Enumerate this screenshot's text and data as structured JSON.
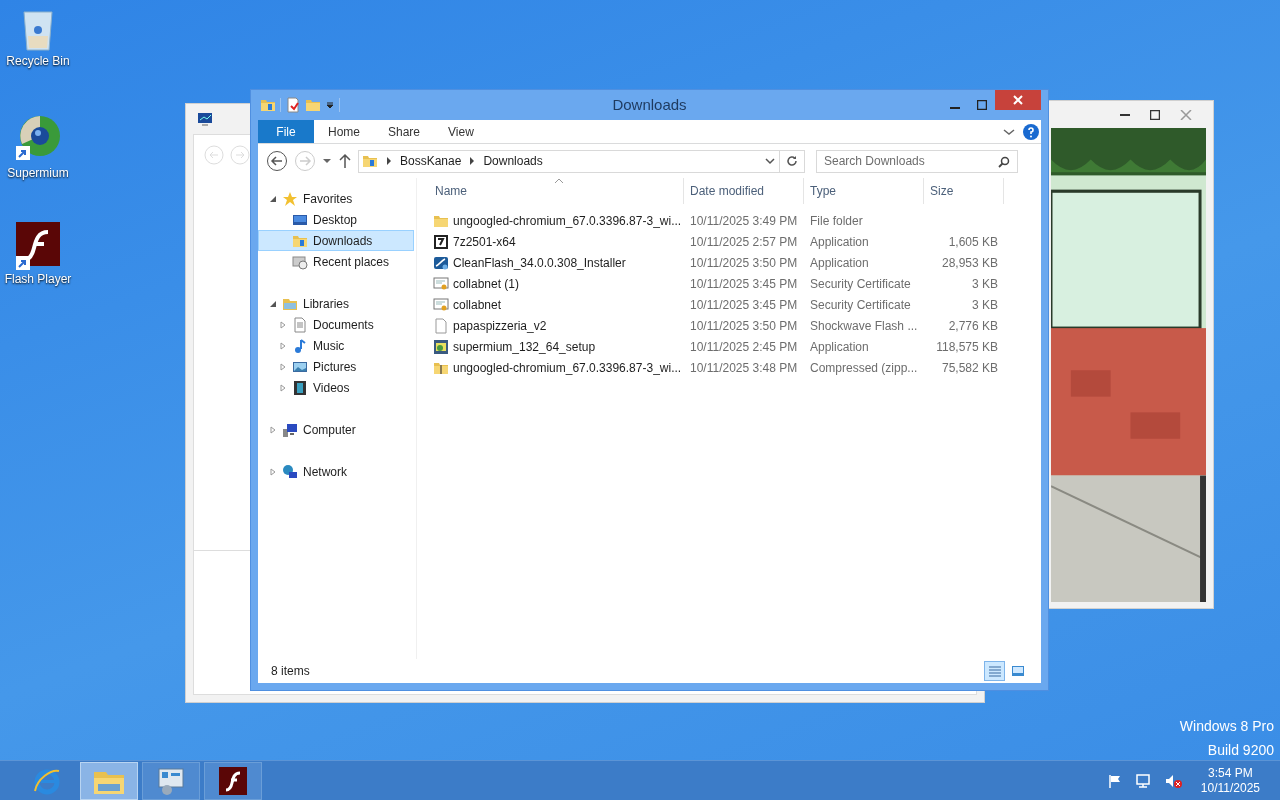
{
  "desktop_icons": [
    {
      "label": "Recycle Bin",
      "kind": "recycle"
    },
    {
      "label": "Supermium",
      "kind": "browser"
    },
    {
      "label": "Flash Player",
      "kind": "flash"
    }
  ],
  "back_window": {
    "nav_back_disabled": true
  },
  "game_window": {
    "kind": "picture"
  },
  "explorer": {
    "title": "Downloads",
    "ribbon_tabs": [
      {
        "label": "File",
        "selected": true
      },
      {
        "label": "Home",
        "selected": false
      },
      {
        "label": "Share",
        "selected": false
      },
      {
        "label": "View",
        "selected": false
      }
    ],
    "breadcrumbs": [
      "BossKanae",
      "Downloads"
    ],
    "search": {
      "placeholder": "Search Downloads"
    },
    "nav_tree": [
      {
        "label": "Favorites",
        "kind": "star",
        "expanded": true,
        "selected": false,
        "children": [
          {
            "label": "Desktop",
            "kind": "desktop",
            "selected": false
          },
          {
            "label": "Downloads",
            "kind": "downloads",
            "selected": true
          },
          {
            "label": "Recent places",
            "kind": "recent",
            "selected": false
          }
        ]
      },
      {
        "label": "Libraries",
        "kind": "libraries",
        "expanded": true,
        "selected": false,
        "children": [
          {
            "label": "Documents",
            "kind": "documents",
            "expanded": false,
            "selected": false
          },
          {
            "label": "Music",
            "kind": "music",
            "expanded": false,
            "selected": false
          },
          {
            "label": "Pictures",
            "kind": "pictures",
            "expanded": false,
            "selected": false
          },
          {
            "label": "Videos",
            "kind": "videos",
            "expanded": false,
            "selected": false
          }
        ]
      },
      {
        "label": "Computer",
        "kind": "computer",
        "expanded": false,
        "selected": false
      },
      {
        "label": "Network",
        "kind": "network",
        "expanded": false,
        "selected": false
      }
    ],
    "columns": [
      "Name",
      "Date modified",
      "Type",
      "Size"
    ],
    "rows": [
      {
        "name": "ungoogled-chromium_67.0.3396.87-3_wi...",
        "date": "10/11/2025 3:49 PM",
        "type": "File folder",
        "kind": "folder"
      },
      {
        "name": "7z2501-x64",
        "date": "10/11/2025 2:57 PM",
        "type": "Application",
        "size": "1,605 KB",
        "kind": "sevenzip"
      },
      {
        "name": "CleanFlash_34.0.0.308_Installer",
        "date": "10/11/2025 3:50 PM",
        "type": "Application",
        "size": "28,953 KB",
        "kind": "installer"
      },
      {
        "name": "collabnet (1)",
        "date": "10/11/2025 3:45 PM",
        "type": "Security Certificate",
        "size": "3 KB",
        "kind": "cert"
      },
      {
        "name": "collabnet",
        "date": "10/11/2025 3:45 PM",
        "type": "Security Certificate",
        "size": "3 KB",
        "kind": "cert"
      },
      {
        "name": "papaspizzeria_v2",
        "date": "10/11/2025 3:50 PM",
        "type": "Shockwave Flash ...",
        "size": "2,776 KB",
        "kind": "file"
      },
      {
        "name": "supermium_132_64_setup",
        "date": "10/11/2025 2:45 PM",
        "type": "Application",
        "size": "118,575 KB",
        "kind": "setup"
      },
      {
        "name": "ungoogled-chromium_67.0.3396.87-3_wi...",
        "date": "10/11/2025 3:48 PM",
        "type": "Compressed (zipp...",
        "size": "75,582 KB",
        "kind": "zip"
      }
    ],
    "status": "8 items",
    "view_buttons": [
      {
        "kind": "details",
        "selected": true
      },
      {
        "kind": "tiles",
        "selected": false
      }
    ]
  },
  "watermark_text": [
    "Windows 8 Pro",
    "Build 9200"
  ],
  "taskbar": {
    "buttons": [
      {
        "kind": "ie",
        "selected": false
      },
      {
        "kind": "explorer",
        "selected": true
      },
      {
        "kind": "control",
        "selected": false
      },
      {
        "kind": "flash",
        "selected": false
      }
    ],
    "tray": [
      {
        "kind": "flag"
      },
      {
        "kind": "network"
      },
      {
        "kind": "muted"
      }
    ],
    "time": "3:54 PM",
    "date": "10/11/2025"
  }
}
